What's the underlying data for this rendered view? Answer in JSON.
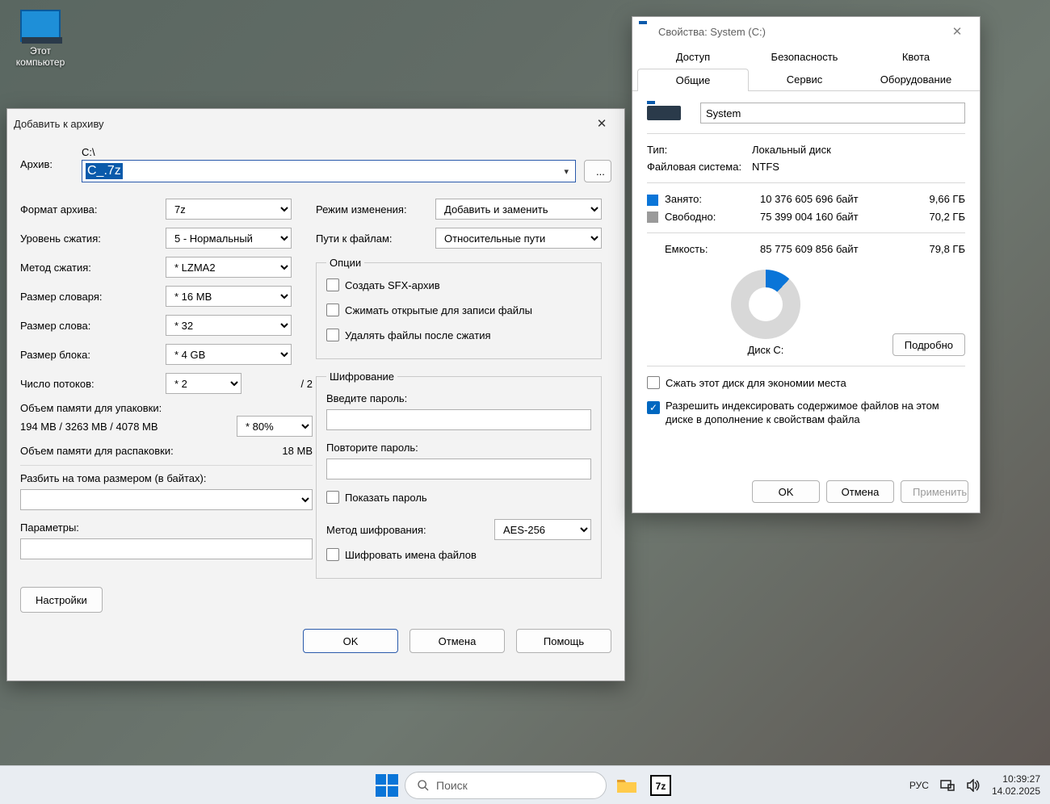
{
  "desktop": {
    "this_pc": "Этот\nкомпьютер"
  },
  "sevenZip": {
    "title": "Добавить к архиву",
    "archive_label": "Архив:",
    "archive_path_prefix": "C:\\",
    "archive_value_selected": "C_.7z",
    "format_label": "Формат архива:",
    "format_value": "7z",
    "level_label": "Уровень сжатия:",
    "level_value": "5 - Нормальный",
    "method_label": "Метод сжатия:",
    "method_value": "* LZMA2",
    "dict_label": "Размер словаря:",
    "dict_value": "* 16 MB",
    "word_label": "Размер слова:",
    "word_value": "* 32",
    "block_label": "Размер блока:",
    "block_value": "* 4 GB",
    "threads_label": "Число потоков:",
    "threads_value": "* 2",
    "threads_of": "/ 2",
    "mem_pack_label": "Объем памяти для упаковки:",
    "mem_pack_detail": "194 MB / 3263 MB / 4078 MB",
    "mem_pack_limit": "* 80%",
    "mem_unpack_label": "Объем памяти для распаковки:",
    "mem_unpack_value": "18 MB",
    "split_label": "Разбить на тома размером (в байтах):",
    "params_label": "Параметры:",
    "settings_btn": "Настройки",
    "mode_label": "Режим изменения:",
    "mode_value": "Добавить и заменить",
    "paths_label": "Пути к файлам:",
    "paths_value": "Относительные пути",
    "options_legend": "Опции",
    "opt_sfx": "Создать SFX-архив",
    "opt_compress_open": "Сжимать открытые для записи файлы",
    "opt_delete_after": "Удалять файлы после сжатия",
    "enc_legend": "Шифрование",
    "enc_pwd": "Введите пароль:",
    "enc_pwd2": "Повторите пароль:",
    "enc_show": "Показать пароль",
    "enc_method_label": "Метод шифрования:",
    "enc_method_value": "AES-256",
    "enc_names": "Шифровать имена файлов",
    "ok": "OK",
    "cancel": "Отмена",
    "help": "Помощь",
    "browse": "..."
  },
  "props": {
    "title": "Свойства: System (C:)",
    "tabs_row1": {
      "access": "Доступ",
      "security": "Безопасность",
      "quota": "Квота"
    },
    "tabs_row2": {
      "general": "Общие",
      "service": "Сервис",
      "hardware": "Оборудование"
    },
    "name_value": "System",
    "type_label": "Тип:",
    "type_value": "Локальный диск",
    "fs_label": "Файловая система:",
    "fs_value": "NTFS",
    "used_label": "Занято:",
    "used_bytes": "10 376 605 696 байт",
    "used_gb": "9,66 ГБ",
    "free_label": "Свободно:",
    "free_bytes": "75 399 004 160 байт",
    "free_gb": "70,2 ГБ",
    "cap_label": "Емкость:",
    "cap_bytes": "85 775 609 856 байт",
    "cap_gb": "79,8 ГБ",
    "disk_caption": "Диск C:",
    "details_btn": "Подробно",
    "compress_chk": "Сжать этот диск для экономии места",
    "index_chk": "Разрешить индексировать содержимое файлов на этом диске в дополнение к свойствам файла",
    "ok": "OK",
    "cancel": "Отмена",
    "apply": "Применить"
  },
  "taskbar": {
    "search_placeholder": "Поиск",
    "lang": "РУС",
    "time": "10:39:27",
    "date": "14.02.2025"
  },
  "chart_data": {
    "type": "pie",
    "title": "Диск C:",
    "categories": [
      "Занято",
      "Свободно"
    ],
    "values": [
      10376605696,
      75399004160
    ],
    "colors": [
      "#0a75d8",
      "#d8d8d8"
    ]
  }
}
